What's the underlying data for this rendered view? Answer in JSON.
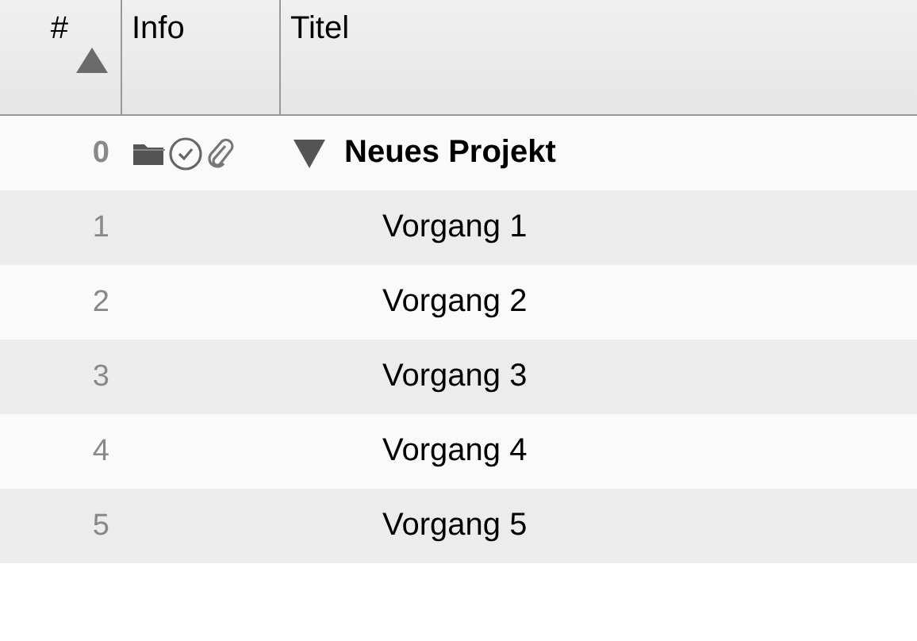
{
  "columns": [
    {
      "label": "#",
      "sorted": true
    },
    {
      "label": "Info",
      "sorted": false
    },
    {
      "label": "Titel",
      "sorted": false
    }
  ],
  "rows": [
    {
      "kind": "project",
      "number": "0",
      "title": "Neues Projekt",
      "expanded": true,
      "children": [
        {
          "number": "1",
          "title": "Vorgang 1"
        },
        {
          "number": "2",
          "title": "Vorgang 2"
        },
        {
          "number": "3",
          "title": "Vorgang 3"
        },
        {
          "number": "4",
          "title": "Vorgang 4"
        },
        {
          "number": "5",
          "title": "Vorgang 5"
        }
      ]
    }
  ]
}
